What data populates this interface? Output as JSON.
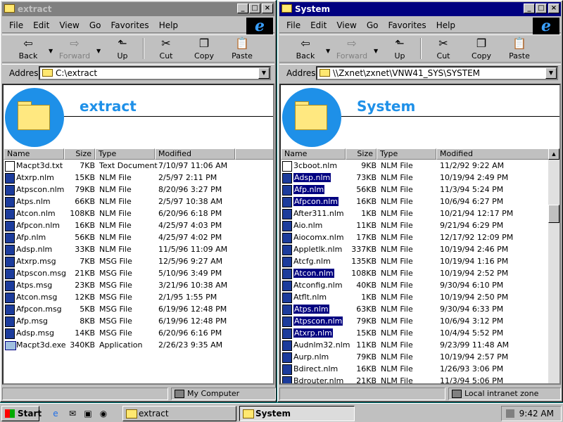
{
  "windows": [
    {
      "id": "w1",
      "title": "extract",
      "active": false,
      "menu": [
        "File",
        "Edit",
        "View",
        "Go",
        "Favorites",
        "Help"
      ],
      "toolbar": {
        "back": "Back",
        "forward": "Forward",
        "up": "Up",
        "cut": "Cut",
        "copy": "Copy",
        "paste": "Paste"
      },
      "address_label": "Address",
      "address": "C:\\extract",
      "banner_title": "extract",
      "columns": {
        "name": "Name",
        "size": "Size",
        "type": "Type",
        "modified": "Modified"
      },
      "files": [
        {
          "name": "Macpt3d.txt",
          "size": "7KB",
          "type": "Text Document",
          "modified": "7/10/97 11:06 AM",
          "icon": "txt",
          "selected": false
        },
        {
          "name": "Atxrp.nlm",
          "size": "15KB",
          "type": "NLM File",
          "modified": "2/5/97 2:11 PM",
          "icon": "nlm",
          "selected": false
        },
        {
          "name": "Atpscon.nlm",
          "size": "79KB",
          "type": "NLM File",
          "modified": "8/20/96 3:27 PM",
          "icon": "nlm",
          "selected": false
        },
        {
          "name": "Atps.nlm",
          "size": "66KB",
          "type": "NLM File",
          "modified": "2/5/97 10:38 AM",
          "icon": "nlm",
          "selected": false
        },
        {
          "name": "Atcon.nlm",
          "size": "108KB",
          "type": "NLM File",
          "modified": "6/20/96 6:18 PM",
          "icon": "nlm",
          "selected": false
        },
        {
          "name": "Afpcon.nlm",
          "size": "16KB",
          "type": "NLM File",
          "modified": "4/25/97 4:03 PM",
          "icon": "nlm",
          "selected": false
        },
        {
          "name": "Afp.nlm",
          "size": "56KB",
          "type": "NLM File",
          "modified": "4/25/97 4:02 PM",
          "icon": "nlm",
          "selected": false
        },
        {
          "name": "Adsp.nlm",
          "size": "33KB",
          "type": "NLM File",
          "modified": "11/5/96 11:09 AM",
          "icon": "nlm",
          "selected": false
        },
        {
          "name": "Atxrp.msg",
          "size": "7KB",
          "type": "MSG File",
          "modified": "12/5/96 9:27 AM",
          "icon": "nlm",
          "selected": false
        },
        {
          "name": "Atpscon.msg",
          "size": "21KB",
          "type": "MSG File",
          "modified": "5/10/96 3:49 PM",
          "icon": "nlm",
          "selected": false
        },
        {
          "name": "Atps.msg",
          "size": "23KB",
          "type": "MSG File",
          "modified": "3/21/96 10:38 AM",
          "icon": "nlm",
          "selected": false
        },
        {
          "name": "Atcon.msg",
          "size": "12KB",
          "type": "MSG File",
          "modified": "2/1/95 1:55 PM",
          "icon": "nlm",
          "selected": false
        },
        {
          "name": "Afpcon.msg",
          "size": "5KB",
          "type": "MSG File",
          "modified": "6/19/96 12:48 PM",
          "icon": "nlm",
          "selected": false
        },
        {
          "name": "Afp.msg",
          "size": "8KB",
          "type": "MSG File",
          "modified": "6/19/96 12:48 PM",
          "icon": "nlm",
          "selected": false
        },
        {
          "name": "Adsp.msg",
          "size": "14KB",
          "type": "MSG File",
          "modified": "6/20/96 6:16 PM",
          "icon": "nlm",
          "selected": false
        },
        {
          "name": "Macpt3d.exe",
          "size": "340KB",
          "type": "Application",
          "modified": "2/26/23 9:35 AM",
          "icon": "app",
          "selected": false
        }
      ],
      "status_zone": "My Computer"
    },
    {
      "id": "w2",
      "title": "System",
      "active": true,
      "menu": [
        "File",
        "Edit",
        "View",
        "Go",
        "Favorites",
        "Help"
      ],
      "toolbar": {
        "back": "Back",
        "forward": "Forward",
        "up": "Up",
        "cut": "Cut",
        "copy": "Copy",
        "paste": "Paste"
      },
      "address_label": "Address",
      "address": "\\\\Zxnet\\zxnet\\VNW41_SYS\\SYSTEM",
      "banner_title": "System",
      "columns": {
        "name": "Name",
        "size": "Size",
        "type": "Type",
        "modified": "Modified"
      },
      "files": [
        {
          "name": "3cboot.nlm",
          "size": "9KB",
          "type": "NLM File",
          "modified": "11/2/92 9:22 AM",
          "icon": "txt",
          "selected": false
        },
        {
          "name": "Adsp.nlm",
          "size": "73KB",
          "type": "NLM File",
          "modified": "10/19/94 2:49 PM",
          "icon": "nlm",
          "selected": true
        },
        {
          "name": "Afp.nlm",
          "size": "56KB",
          "type": "NLM File",
          "modified": "11/3/94 5:24 PM",
          "icon": "nlm",
          "selected": true
        },
        {
          "name": "Afpcon.nlm",
          "size": "16KB",
          "type": "NLM File",
          "modified": "10/6/94 6:27 PM",
          "icon": "nlm",
          "selected": true
        },
        {
          "name": "After311.nlm",
          "size": "1KB",
          "type": "NLM File",
          "modified": "10/21/94 12:17 PM",
          "icon": "nlm",
          "selected": false
        },
        {
          "name": "Aio.nlm",
          "size": "11KB",
          "type": "NLM File",
          "modified": "9/21/94 6:29 PM",
          "icon": "nlm",
          "selected": false
        },
        {
          "name": "Aiocomx.nlm",
          "size": "17KB",
          "type": "NLM File",
          "modified": "12/17/92 12:09 PM",
          "icon": "nlm",
          "selected": false
        },
        {
          "name": "Appletlk.nlm",
          "size": "337KB",
          "type": "NLM File",
          "modified": "10/19/94 2:46 PM",
          "icon": "nlm",
          "selected": false
        },
        {
          "name": "Atcfg.nlm",
          "size": "135KB",
          "type": "NLM File",
          "modified": "10/19/94 1:16 PM",
          "icon": "nlm",
          "selected": false
        },
        {
          "name": "Atcon.nlm",
          "size": "108KB",
          "type": "NLM File",
          "modified": "10/19/94 2:52 PM",
          "icon": "nlm",
          "selected": true
        },
        {
          "name": "Atconfig.nlm",
          "size": "40KB",
          "type": "NLM File",
          "modified": "9/30/94 6:10 PM",
          "icon": "nlm",
          "selected": false
        },
        {
          "name": "Atflt.nlm",
          "size": "1KB",
          "type": "NLM File",
          "modified": "10/19/94 2:50 PM",
          "icon": "nlm",
          "selected": false
        },
        {
          "name": "Atps.nlm",
          "size": "63KB",
          "type": "NLM File",
          "modified": "9/30/94 6:33 PM",
          "icon": "nlm",
          "selected": true
        },
        {
          "name": "Atpscon.nlm",
          "size": "79KB",
          "type": "NLM File",
          "modified": "10/6/94 3:12 PM",
          "icon": "nlm",
          "selected": true
        },
        {
          "name": "Atxrp.nlm",
          "size": "15KB",
          "type": "NLM File",
          "modified": "10/4/94 5:52 PM",
          "icon": "nlm",
          "selected": true
        },
        {
          "name": "Audnlm32.nlm",
          "size": "11KB",
          "type": "NLM File",
          "modified": "9/23/99 11:48 AM",
          "icon": "nlm",
          "selected": false
        },
        {
          "name": "Aurp.nlm",
          "size": "79KB",
          "type": "NLM File",
          "modified": "10/19/94 2:57 PM",
          "icon": "nlm",
          "selected": false
        },
        {
          "name": "Bdirect.nlm",
          "size": "16KB",
          "type": "NLM File",
          "modified": "1/26/93 3:06 PM",
          "icon": "nlm",
          "selected": false
        },
        {
          "name": "Bdrouter.nlm",
          "size": "21KB",
          "type": "NLM File",
          "modified": "11/3/94 5:06 PM",
          "icon": "nlm",
          "selected": false
        }
      ],
      "status_zone": "Local intranet zone"
    }
  ],
  "taskbar": {
    "start_label": "Start",
    "tasks": [
      {
        "label": "extract",
        "active": false
      },
      {
        "label": "System",
        "active": true
      }
    ],
    "clock": "9:42 AM"
  }
}
